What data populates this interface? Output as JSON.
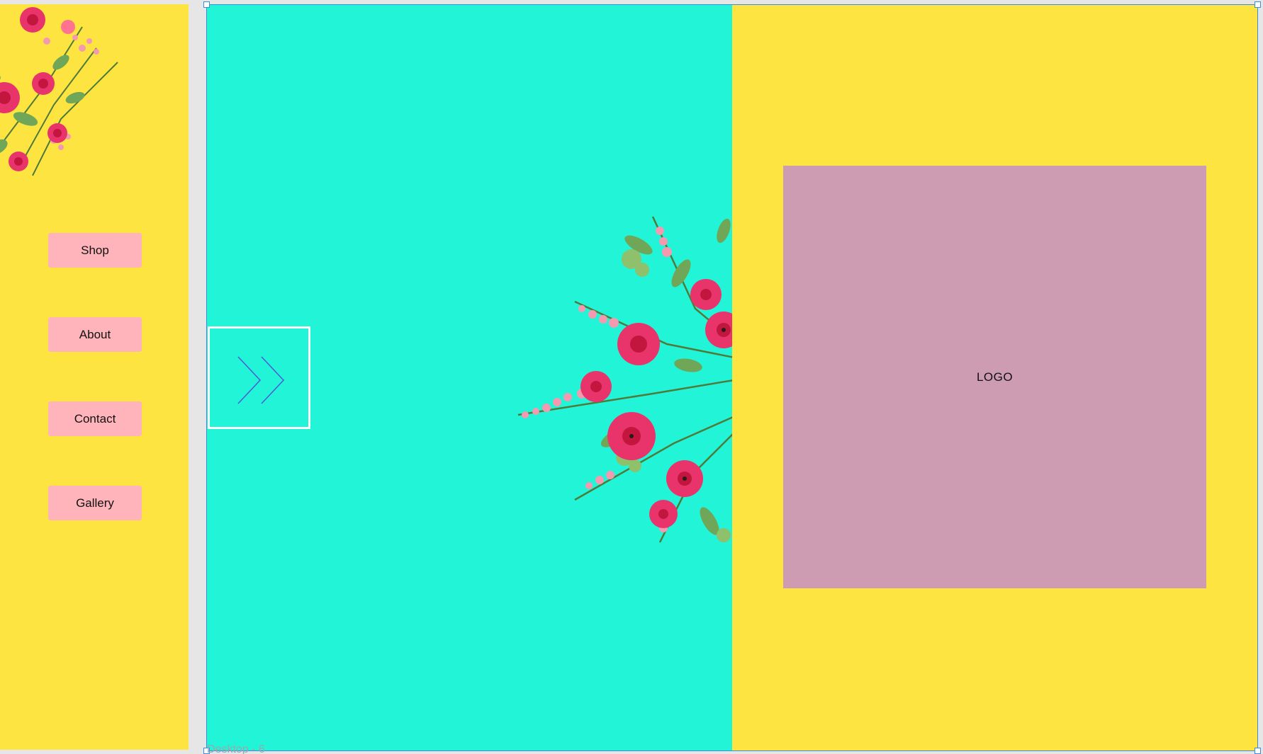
{
  "sidebar": {
    "buttons": [
      {
        "label": "Shop"
      },
      {
        "label": "About"
      },
      {
        "label": "Contact"
      },
      {
        "label": "Gallery"
      }
    ]
  },
  "hero": {
    "logo_text": "LOGO",
    "arrow_icon": "double-chevron-right-icon"
  },
  "canvas": {
    "frame_label": "Desktop - 6"
  },
  "colors": {
    "yellow": "#fee440",
    "teal": "#22f5d7",
    "button_pink": "#ffb3ba",
    "logo_mauve": "#ce9cb2",
    "selection_blue": "#3a8dde"
  }
}
